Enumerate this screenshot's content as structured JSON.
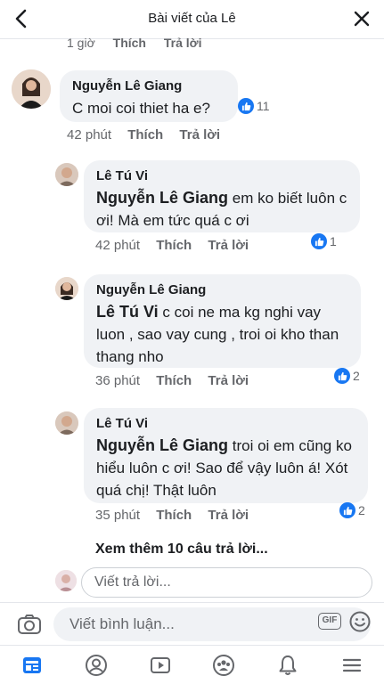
{
  "header": {
    "title": "Bài viết của Lê"
  },
  "cut_row": {
    "time": "1 giờ",
    "like": "Thích",
    "reply": "Trả lời"
  },
  "comments": [
    {
      "name": "Nguyễn Lê Giang",
      "mention": "",
      "text": "C moi coi thiet ha e?",
      "time": "42 phút",
      "like": "Thích",
      "reply": "Trả lời",
      "reactions": "11"
    },
    {
      "name": "Lê Tú Vi",
      "mention": "Nguyễn Lê Giang",
      "text": " em ko biết luôn c ơi! Mà em tức quá c ơi",
      "time": "42 phút",
      "like": "Thích",
      "reply": "Trả lời",
      "reactions": "1"
    },
    {
      "name": "Nguyễn Lê Giang",
      "mention": "Lê Tú Vi",
      "text": " c coi ne ma kg nghi vay luon , sao vay cung , troi oi kho than thang nho",
      "time": "36 phút",
      "like": "Thích",
      "reply": "Trả lời",
      "reactions": "2"
    },
    {
      "name": "Lê Tú Vi",
      "mention": "Nguyễn Lê Giang",
      "text": "  troi oi em cũng ko hiểu luôn c ơi! Sao để vậy luôn á! Xót quá chị! Thật luôn",
      "time": "35 phút",
      "like": "Thích",
      "reply": "Trả lời",
      "reactions": "2"
    }
  ],
  "see_more": "Xem thêm 10 câu trả lời...",
  "reply_placeholder": "Viết trả lời...",
  "composer": {
    "placeholder": "Viết bình luận...",
    "gif_label": "GIF"
  },
  "colors": {
    "accent": "#1877f2",
    "bubble": "#f0f2f5",
    "muted": "#65676b"
  },
  "nav": [
    "news-feed-icon",
    "profile-icon",
    "watch-icon",
    "groups-icon",
    "notifications-icon",
    "menu-icon"
  ]
}
